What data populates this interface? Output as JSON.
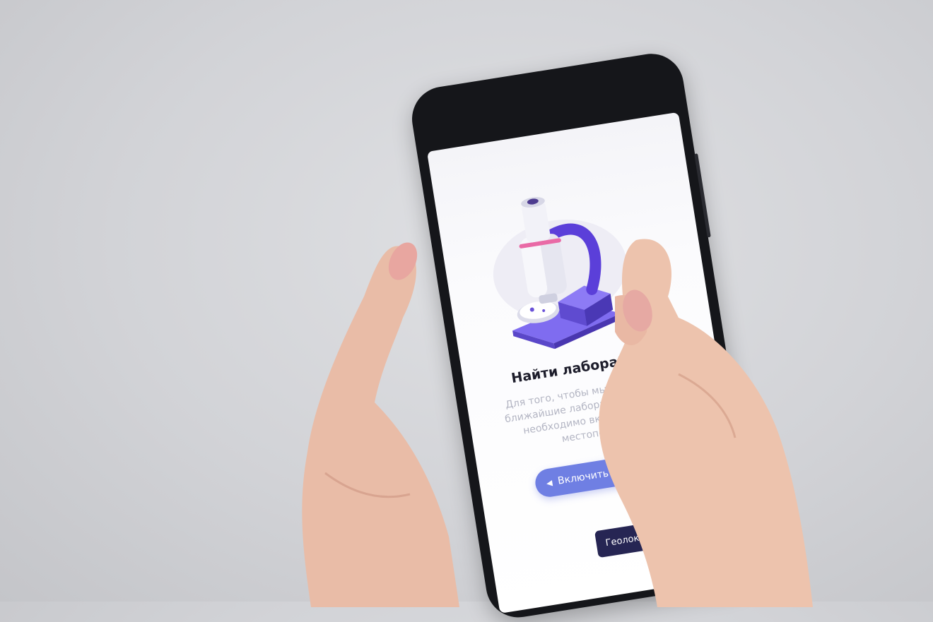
{
  "screen": {
    "illustration_icon": "microscope-icon",
    "title": "Найти лабораборию",
    "description": "Для того, чтобы мы могли показ вам ближайшие лаборатории с адресами, необходимо включить доступ к местоположению",
    "geolocation_button": {
      "icon": "location-arrow-icon",
      "label": "Включить геолокацию"
    },
    "toast": "Геолокация включена"
  },
  "colors": {
    "button_accent": "#6f7fe3",
    "toast_bg": "#262553",
    "microscope_purple": "#6a52d8",
    "microscope_pink": "#e96aa6"
  }
}
